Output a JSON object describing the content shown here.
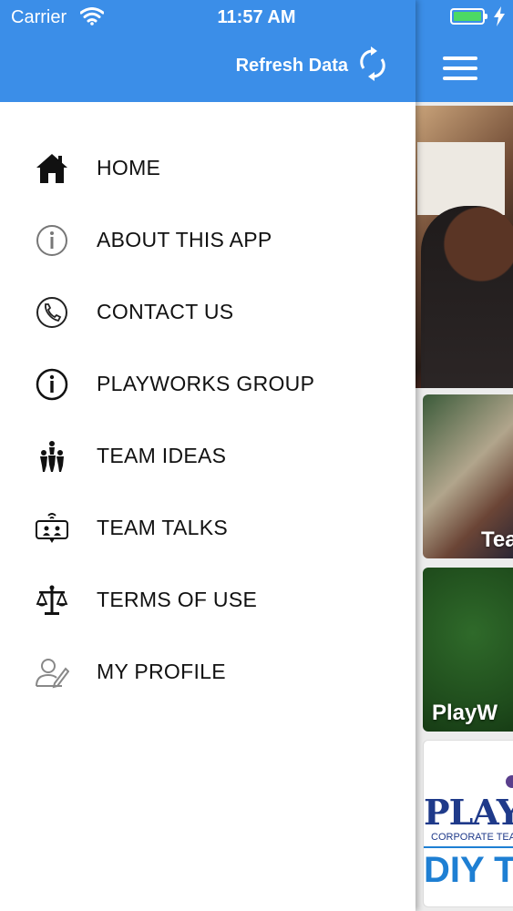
{
  "status_bar": {
    "carrier": "Carrier",
    "time": "11:57 AM"
  },
  "drawer": {
    "refresh_label": "Refresh Data",
    "items": [
      {
        "label": "HOME",
        "icon": "home-icon"
      },
      {
        "label": "ABOUT THIS APP",
        "icon": "info-outline-icon"
      },
      {
        "label": "CONTACT US",
        "icon": "phone-circle-icon"
      },
      {
        "label": "PLAYWORKS GROUP",
        "icon": "info-circle-icon"
      },
      {
        "label": "TEAM IDEAS",
        "icon": "team-people-icon"
      },
      {
        "label": "TEAM TALKS",
        "icon": "video-talk-icon"
      },
      {
        "label": "TERMS OF USE",
        "icon": "scales-icon"
      },
      {
        "label": "MY PROFILE",
        "icon": "profile-edit-icon"
      }
    ]
  },
  "main": {
    "cards": [
      {
        "label": "Tea"
      },
      {
        "label": "PlayW"
      },
      {
        "brand": "PLAYW",
        "brand_sub": "CORPORATE TEA",
        "brand_big": "DIY T"
      }
    ]
  },
  "colors": {
    "header": "#3b8ee8",
    "battery": "#4cd964",
    "brand_dark": "#1f3a8a",
    "brand_light": "#1e7fd3"
  }
}
